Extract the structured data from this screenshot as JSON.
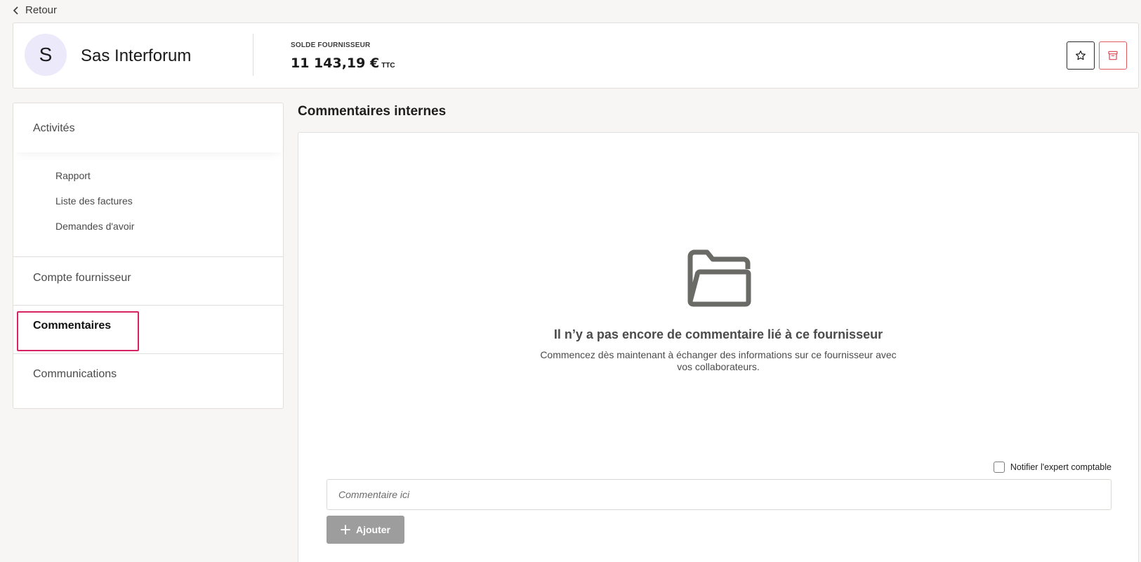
{
  "nav": {
    "back_label": "Retour"
  },
  "header": {
    "avatar_letter": "S",
    "supplier_name": "Sas Interforum",
    "balance_label": "SOLDE FOURNISSEUR",
    "balance_value": "11 143,19 €",
    "balance_suffix": "TTC"
  },
  "sidebar": {
    "activites": "Activités",
    "sub_items": [
      "Rapport",
      "Liste des factures",
      "Demandes d'avoir"
    ],
    "compte": "Compte fournisseur",
    "commentaires": "Commentaires",
    "communications": "Communications",
    "selected": "Commentaires"
  },
  "main": {
    "title": "Commentaires internes",
    "empty_title": "Il n’y a pas encore de commentaire lié à ce fournisseur",
    "empty_desc": "Commencez dès maintenant à échanger des informations sur ce fournisseur avec vos collaborateurs.",
    "notify_label": "Notifier l'expert comptable",
    "notify_checked": false,
    "comment_placeholder": "Commentaire ici",
    "comment_value": "",
    "add_button": "Ajouter"
  },
  "colors": {
    "accent_selected": "#d92464",
    "archive_border": "#e05a64",
    "avatar_bg": "#ece9fb",
    "add_button_bg": "#9d9d9d"
  },
  "icons": [
    "chevron-left-icon",
    "star-icon",
    "archive-icon",
    "folder-open-icon",
    "plus-icon"
  ]
}
